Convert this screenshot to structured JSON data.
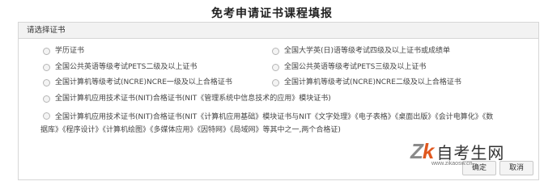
{
  "title": "免考申请证书课程填报",
  "panel": {
    "header": "请选择证书"
  },
  "options": [
    {
      "label": "学历证书"
    },
    {
      "label": "全国大学英(日)语等级考试四级及以上证书或成绩单"
    },
    {
      "label": "全国公共英语等级考试PETS二级及以上证书"
    },
    {
      "label": "全国公共英语等级考试PETS三级及以上证书"
    },
    {
      "label": "全国计算机等级考试(NCRE)NCRE一级及以上合格证书"
    },
    {
      "label": "全国计算机等级考试(NCRE)NCRE二级及以上合格证书"
    },
    {
      "label": "全国计算机应用技术证书(NIT)合格证书(NIT《管理系统中信息技术的应用》模块证书)"
    },
    {
      "label": "全国计算机应用技术证书(NIT)合格证书(NIT《计算机应用基础》模块证书与NIT《文字处理》《电子表格》《桌面出版》《会计电算化》《数据库》《程序设计》《计算机绘图》《多媒体应用》《因特网》《局域网》等其中之一,两个合格证)"
    }
  ],
  "buttons": {
    "confirm": "确定",
    "cancel": "取消"
  },
  "watermark": {
    "logo_main": "Z",
    "logo_k": "k",
    "text": "自考生网",
    "url": "www.zikaosw.cn"
  }
}
